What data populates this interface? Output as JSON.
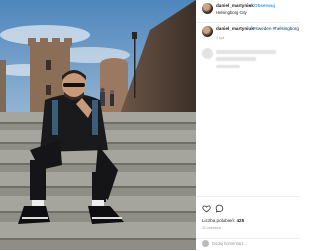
{
  "header": {
    "username": "daniel_martyniuk",
    "separator": "•",
    "follow_label": "Obserwuj",
    "location": "Helsingborg City"
  },
  "caption": {
    "username": "daniel_martyniuk",
    "hashtags": "#sweden #helsingborg",
    "time_ago": "1 tyd."
  },
  "actions": {
    "like_icon": "heart-icon",
    "comment_icon": "comment-bubble-icon",
    "likes_label": "Liczba polubień:",
    "likes_count": "425",
    "date_label": "11 czerwca"
  },
  "add_comment": {
    "placeholder": "Dodaj komentarz..."
  },
  "colors": {
    "link_blue": "#3897f0",
    "hashtag_blue": "#003569",
    "text_dark": "#262626",
    "text_muted": "#999999",
    "border": "#efefef"
  }
}
